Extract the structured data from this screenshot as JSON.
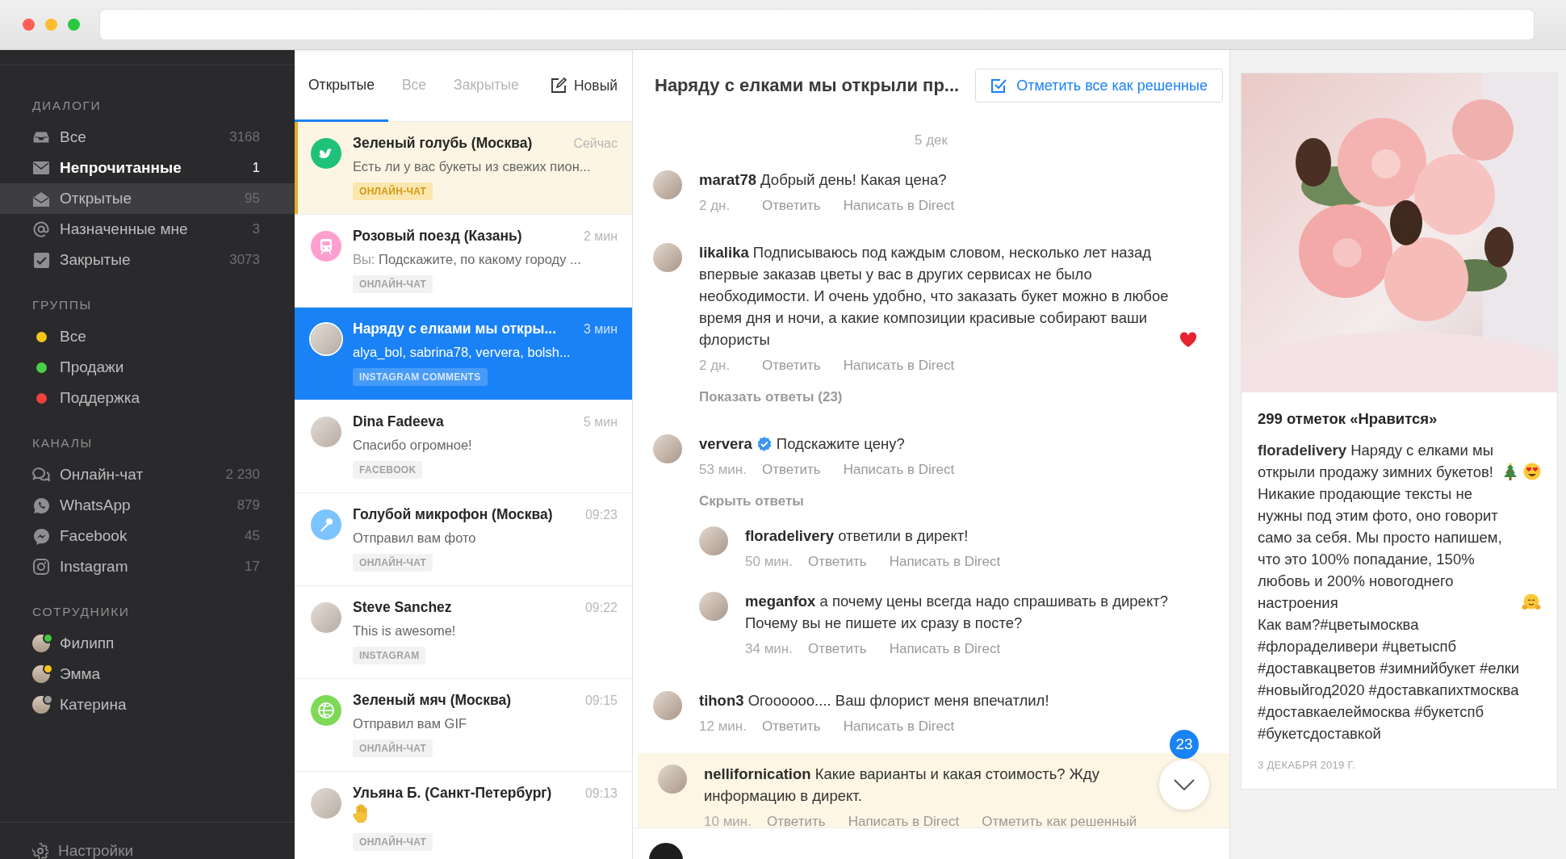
{
  "sidebar": {
    "sections": [
      {
        "heading": "ДИАЛОГИ",
        "items": [
          {
            "kind": "folder",
            "label": "Все",
            "count": "3168",
            "selected": false,
            "unread": false
          },
          {
            "kind": "folder",
            "label": "Непрочитанные",
            "count": "1",
            "selected": false,
            "unread": true
          },
          {
            "kind": "folder",
            "label": "Открытые",
            "count": "95",
            "selected": true,
            "unread": false
          },
          {
            "kind": "folder",
            "label": "Назначенные мне",
            "count": "3",
            "selected": false,
            "unread": false
          },
          {
            "kind": "folder",
            "label": "Закрытые",
            "count": "3073",
            "selected": false,
            "unread": false
          }
        ]
      },
      {
        "heading": "ГРУППЫ",
        "items": [
          {
            "kind": "group",
            "label": "Все",
            "color": "#f5c518",
            "selected": false
          },
          {
            "kind": "group",
            "label": "Продажи",
            "color": "#4ccf48",
            "selected": false
          },
          {
            "kind": "group",
            "label": "Поддержка",
            "color": "#f2413a",
            "selected": false
          }
        ]
      },
      {
        "heading": "КАНАЛЫ",
        "items": [
          {
            "kind": "channel",
            "label": "Онлайн-чат",
            "count": "2 230",
            "selected": false
          },
          {
            "kind": "channel",
            "label": "WhatsApp",
            "count": "879",
            "selected": false
          },
          {
            "kind": "channel",
            "label": "Facebook",
            "count": "45",
            "selected": false
          },
          {
            "kind": "channel",
            "label": "Instagram",
            "count": "17",
            "selected": false
          }
        ]
      },
      {
        "heading": "СОТРУДНИКИ",
        "items": [
          {
            "kind": "staff",
            "label": "Филипп",
            "color": "#3fc83f",
            "selected": false
          },
          {
            "kind": "staff",
            "label": "Эмма",
            "color": "#f5c518",
            "selected": false
          },
          {
            "kind": "staff",
            "label": "Катерина",
            "color": "#9a9a9a",
            "selected": false
          }
        ]
      }
    ],
    "settings": "Настройки"
  },
  "conversation_tabs": [
    {
      "label": "Открытые",
      "selected": true
    },
    {
      "label": "Все",
      "selected": false
    },
    {
      "label": "Закрытые",
      "selected": false
    }
  ],
  "new_button": "Новый",
  "conversations": [
    {
      "kind": "text",
      "title": "Зеленый голубь (Москва)",
      "time": "Сейчас",
      "preview": "Есть ли у вас букеты из свежих пион...",
      "tag": "ОНЛАЙН-ЧАТ",
      "avatar": {
        "kind": "emblem",
        "color": "#1fc27a"
      },
      "selected": false,
      "unread": true
    },
    {
      "kind": "text",
      "title": "Розовый поезд (Казань)",
      "time": "2 мин",
      "preview_prefix": "Вы:",
      "preview": "Подскажите, по какому городу ...",
      "tag": "ОНЛАЙН-ЧАТ",
      "avatar": {
        "kind": "emblem",
        "color": "#ff9fd0"
      },
      "selected": false,
      "unread": false
    },
    {
      "kind": "text",
      "title": "Наряду с елками мы откры...",
      "time": "3 мин",
      "preview": "alya_bol, sabrina78, ververa, bolsh...",
      "tag": "INSTAGRAM COMMENTS",
      "selected": true,
      "unread": false
    },
    {
      "kind": "text",
      "title": "Dina Fadeeva",
      "time": "5 мин",
      "preview": "Спасибо огромное!",
      "tag": "FACEBOOK",
      "selected": false,
      "unread": false
    },
    {
      "kind": "text",
      "title": "Голубой микрофон (Москва)",
      "time": "09:23",
      "preview": "Отправил вам фото",
      "tag": "ОНЛАЙН-ЧАТ",
      "avatar": {
        "kind": "emblem",
        "color": "#7cc4ff"
      },
      "selected": false,
      "unread": false
    },
    {
      "kind": "text",
      "title": "Steve Sanchez",
      "time": "09:22",
      "preview": "This is awesome!",
      "tag": "INSTAGRAM",
      "selected": false,
      "unread": false
    },
    {
      "kind": "text",
      "title": "Зеленый мяч (Москва)",
      "time": "09:15",
      "preview": "Отправил вам GIF",
      "tag": "ОНЛАЙН-ЧАТ",
      "avatar": {
        "kind": "emblem",
        "color": "#7ed957"
      },
      "selected": false,
      "unread": false
    },
    {
      "kind": "emoji",
      "title": "Ульяна Б. (Санкт-Петербург)",
      "time": "09:13",
      "tag": "ОНЛАЙН-ЧАТ",
      "selected": false,
      "unread": false
    }
  ],
  "chat": {
    "title": "Наряду с елками мы открыли пр...",
    "resolve_all": "Отметить все как решенные",
    "date": "5 дек",
    "messages": [
      {
        "author": "marat78",
        "verified": false,
        "text": "Добрый день! Какая цена?",
        "time": "2 дн.",
        "actions": [
          "Ответить",
          "Написать в Direct"
        ],
        "highlighted": false
      },
      {
        "author": "likalika",
        "verified": false,
        "text": "Подписываюсь под каждым словом, несколько лет назад впервые заказав цветы у вас в других сервисах не было необходимости. И очень удобно, что заказать букет можно в любое время дня и ночи, а какие композиции красивые собирают ваши флористы",
        "trailing_emoji": true,
        "time": "2 дн.",
        "actions": [
          "Ответить",
          "Написать в Direct"
        ],
        "replies_link": "Показать ответы (23)",
        "highlighted": false
      },
      {
        "author": "ververa",
        "verified": true,
        "text": "Подскажите цену?",
        "time": "53 мин.",
        "actions": [
          "Ответить",
          "Написать в Direct"
        ],
        "replies_link": "Скрыть ответы",
        "highlighted": false,
        "children": [
          {
            "author": "floradelivery",
            "verified": false,
            "text": "ответили в директ!",
            "time": "50 мин.",
            "actions": [
              "Ответить",
              "Написать в Direct"
            ],
            "highlighted": false
          },
          {
            "author": "meganfox",
            "verified": false,
            "text": "а почему цены всегда надо спрашивать в директ? Почему вы не пишете их сразу в посте?",
            "time": "34 мин.",
            "actions": [
              "Ответить",
              "Написать в Direct"
            ],
            "highlighted": false
          }
        ]
      },
      {
        "author": "tihon3",
        "verified": false,
        "text": "Огоооооо.... Ваш флорист меня впечатлил!",
        "time": "12 мин.",
        "actions": [
          "Ответить",
          "Написать в Direct"
        ],
        "highlighted": false
      },
      {
        "author": "nellifornication",
        "verified": false,
        "text": "Какие варианты и какая стоимость? Жду информацию в директ.",
        "time": "10 мин.",
        "actions": [
          "Ответить",
          "Написать в Direct",
          "Отметить как решенный"
        ],
        "highlighted": true
      }
    ],
    "unread_badge": "23"
  },
  "post": {
    "likes": "299 отметок «Нравится»",
    "caption": [
      {
        "kind": "text",
        "text": "**floradelivery** Наряду с елками мы открыли продажу зимних букетов!"
      },
      {
        "kind": "emoji"
      },
      {
        "kind": "emoji"
      },
      {
        "kind": "text",
        "text": "Никакие продающие тексты не нужны под этим фото, оно говорит само за себя. Мы просто напишем, что это 100% попадание, 150% любовь и 200% новогоднего настроения"
      },
      {
        "kind": "emoji"
      },
      {
        "kind": "text",
        "text": "Как вам?#цветымосква #флораделивери #цветыспб #доставкацветов #зимнийбукет #елки #новыйгод2020 #доставкапихтмосква #доставкаелеймосква #букетспб #букетсдоставкой"
      }
    ],
    "date": "3 ДЕКАБРЯ 2019 Г."
  }
}
